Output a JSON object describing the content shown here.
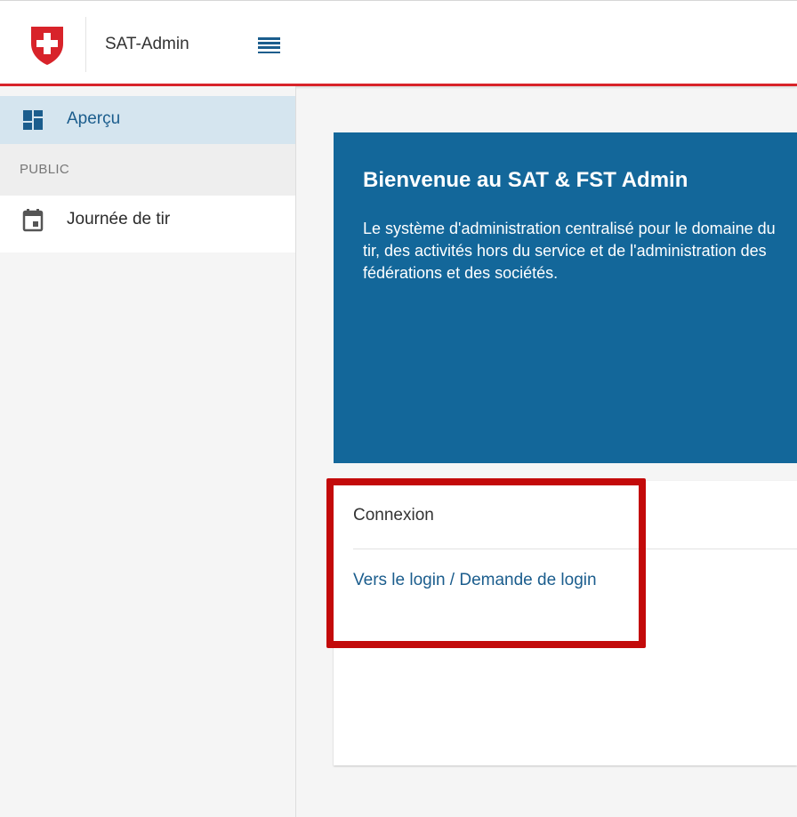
{
  "header": {
    "app_title": "SAT-Admin",
    "logo_icon": "swiss-shield-icon",
    "menu_icon": "hamburger-menu-icon"
  },
  "sidebar": {
    "items": [
      {
        "label": "Aperçu",
        "icon": "dashboard-icon",
        "active": true
      }
    ],
    "section_label": "PUBLIC",
    "public_items": [
      {
        "label": "Journée de tir",
        "icon": "calendar-icon"
      }
    ]
  },
  "hero": {
    "title": "Bienvenue au SAT & FST Admin",
    "text": "Le système d'administration centralisé pour le domaine du tir, des activités hors du service et de l'administration des fédérations et des sociétés."
  },
  "login_card": {
    "title": "Connexion",
    "link": "Vers le login / Demande de login"
  },
  "colors": {
    "brand_red": "#d8232a",
    "primary_blue": "#13679a",
    "link_blue": "#1b5d8d",
    "highlight_red": "#c30a0a"
  }
}
